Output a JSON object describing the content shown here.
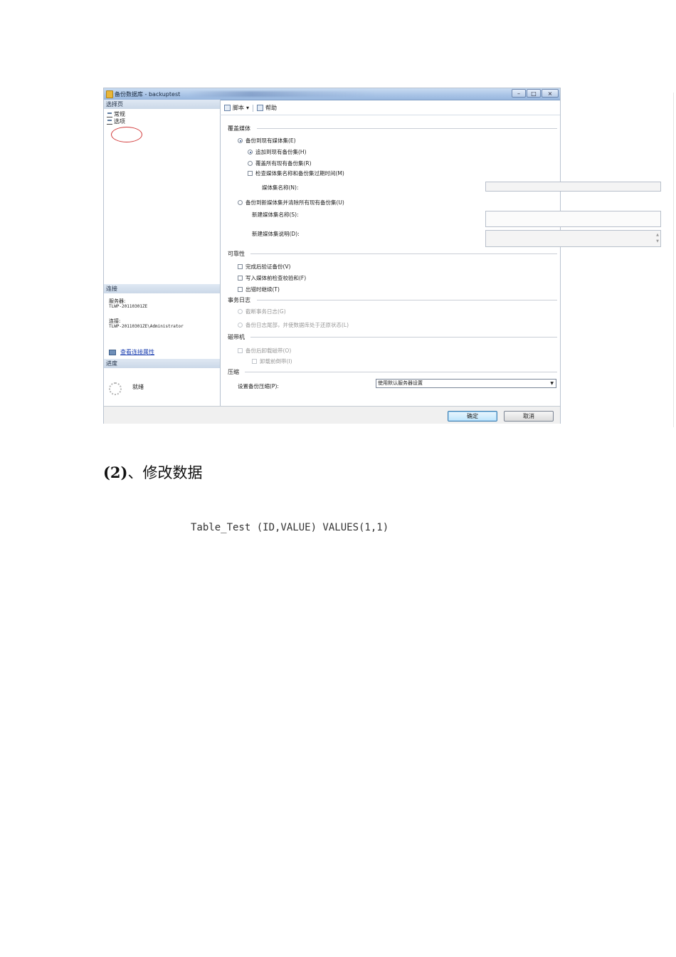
{
  "dialog": {
    "title": "备份数据库 - backuptest",
    "window_buttons": [
      "–",
      "□",
      "×"
    ],
    "left": {
      "select_page_header": "选择页",
      "pages": [
        "常规",
        "选项"
      ],
      "connection_header": "连接",
      "server_label": "服务器:",
      "server_value": "TLWP-20110301ZE",
      "connection_label": "连接:",
      "connection_value": "TLWP-20110301ZE\\Administrator",
      "view_connection_link": "查看连接属性",
      "progress_header": "进度",
      "progress_status": "就绪"
    },
    "toolbar": {
      "script_label": "脚本",
      "dropdown_icon": "▾",
      "help_label": "帮助"
    },
    "overwrite_media": {
      "group_label": "覆盖媒体",
      "backup_existing_label": "备份到现有媒体集(E)",
      "append_label": "追加到现有备份集(H)",
      "overwrite_label": "覆盖所有现有备份集(R)",
      "check_expiry_label": "检查媒体集名称和备份集过期时间(M)",
      "media_set_name_label": "媒体集名称(N):",
      "backup_new_label": "备份到新媒体集并清除所有现有备份集(U)",
      "new_media_set_name_label": "新建媒体集名称(S):",
      "new_media_set_desc_label": "新建媒体集说明(D):"
    },
    "reliability": {
      "group_label": "可靠性",
      "verify_label": "完成后验证备份(V)",
      "checksum_label": "写入媒体前检查校验和(F)",
      "continue_on_error_label": "出错时继续(T)"
    },
    "transaction_log": {
      "group_label": "事务日志",
      "truncate_label": "截断事务日志(G)",
      "tail_log_label": "备份日志尾部，并使数据库处于还原状态(L)"
    },
    "tape_drive": {
      "group_label": "磁带机",
      "unload_label": "备份后卸载磁带(O)",
      "rewind_label": "卸载前倒带(I)"
    },
    "compression": {
      "group_label": "压缩",
      "set_label": "设置备份压缩(P):",
      "selected_value": "使用默认服务器设置"
    },
    "ok_button": "确定",
    "cancel_button": "取消"
  },
  "document": {
    "heading_number": "(2)",
    "heading_text": "、修改数据",
    "code_line": "Table_Test (ID,VALUE) VALUES(1,1)"
  }
}
